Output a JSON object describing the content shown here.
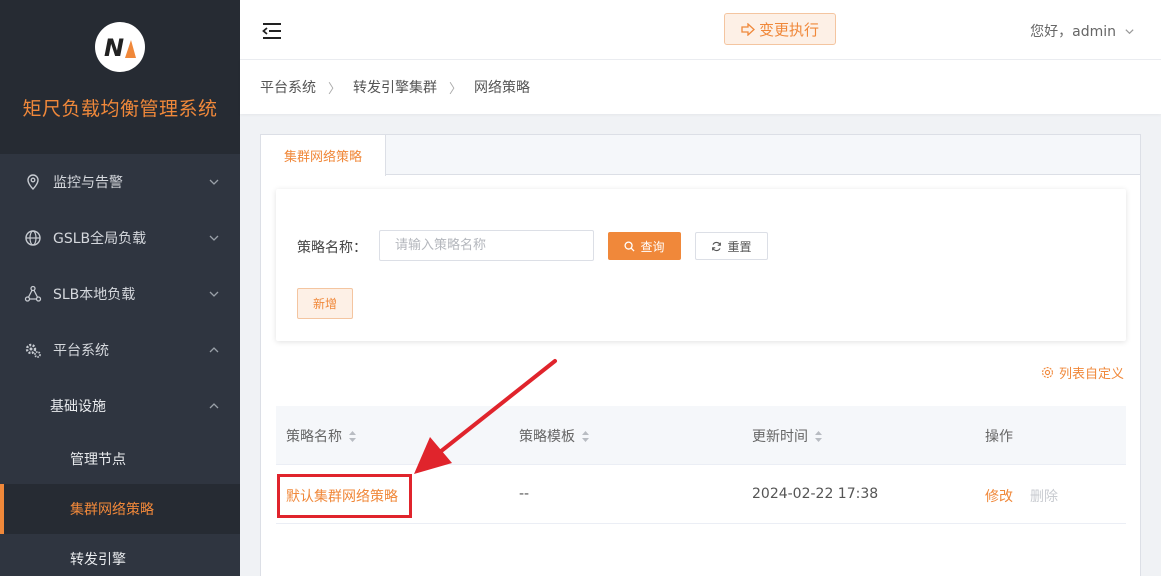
{
  "app": {
    "title": "矩尺负载均衡管理系统"
  },
  "colors": {
    "accent": "#f0883a",
    "sidebar_bg": "#2f3540",
    "annotation": "#e0242c"
  },
  "sidebar": {
    "items": [
      {
        "label": "监控与告警",
        "icon": "location-pin-icon"
      },
      {
        "label": "GSLB全局负载",
        "icon": "globe-icon"
      },
      {
        "label": "SLB本地负载",
        "icon": "share-nodes-icon"
      },
      {
        "label": "平台系统",
        "icon": "gears-icon"
      }
    ],
    "sub_group": {
      "label": "基础设施"
    },
    "leaves": [
      {
        "label": "管理节点"
      },
      {
        "label": "集群网络策略"
      },
      {
        "label": "转发引擎"
      }
    ]
  },
  "header": {
    "exec_label": "变更执行",
    "user_greeting": "您好，admin"
  },
  "breadcrumb": [
    "平台系统",
    "转发引擎集群",
    "网络策略"
  ],
  "tabs": [
    {
      "label": "集群网络策略"
    }
  ],
  "filter": {
    "name_label": "策略名称：",
    "name_placeholder": "请输入策略名称",
    "query_label": "查询",
    "reset_label": "重置",
    "add_label": "新增"
  },
  "table": {
    "customize_label": "列表自定义",
    "columns": [
      "策略名称",
      "策略模板",
      "更新时间",
      "操作"
    ],
    "rows": [
      {
        "name": "默认集群网络策略",
        "template": "--",
        "updated": "2024-02-22 17:38",
        "edit": "修改",
        "delete": "删除"
      }
    ]
  }
}
